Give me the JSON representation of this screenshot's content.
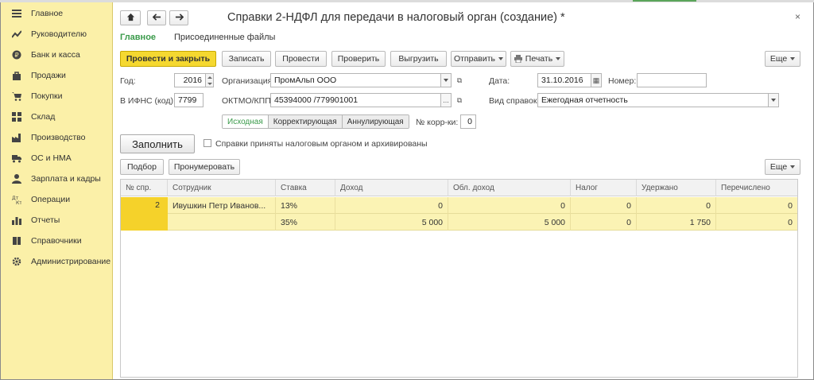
{
  "sidebar": {
    "items": [
      {
        "label": "Главное",
        "icon": "menu-list-icon"
      },
      {
        "label": "Руководителю",
        "icon": "chart-line-icon"
      },
      {
        "label": "Банк и касса",
        "icon": "coin-icon"
      },
      {
        "label": "Продажи",
        "icon": "bag-icon"
      },
      {
        "label": "Покупки",
        "icon": "cart-icon"
      },
      {
        "label": "Склад",
        "icon": "warehouse-icon"
      },
      {
        "label": "Производство",
        "icon": "factory-icon"
      },
      {
        "label": "ОС и НМА",
        "icon": "truck-icon"
      },
      {
        "label": "Зарплата и кадры",
        "icon": "person-icon"
      },
      {
        "label": "Операции",
        "icon": "operations-icon"
      },
      {
        "label": "Отчеты",
        "icon": "bar-chart-icon"
      },
      {
        "label": "Справочники",
        "icon": "book-icon"
      },
      {
        "label": "Администрирование",
        "icon": "gear-icon"
      }
    ]
  },
  "header": {
    "title": "Справки 2-НДФЛ для передачи в налоговый орган (создание) *",
    "close": "×"
  },
  "tabs": {
    "main": "Главное",
    "files": "Присоединенные файлы"
  },
  "toolbar": {
    "post_close": "Провести и закрыть",
    "save": "Записать",
    "post": "Провести",
    "check": "Проверить",
    "upload": "Выгрузить",
    "send": "Отправить",
    "print": "Печать",
    "more": "Еще"
  },
  "form": {
    "year_label": "Год:",
    "year_value": "2016",
    "ifns_label": "В ИФНС (код):",
    "ifns_value": "7799",
    "org_label": "Организация:",
    "org_value": "ПромАльп ООО",
    "oktmo_label": "ОКТМО/КПП:",
    "oktmo_value": "45394000   /779901001",
    "date_label": "Дата:",
    "date_value": "31.10.2016",
    "number_label": "Номер:",
    "number_value": "",
    "kind_label": "Вид справок:",
    "kind_value": "Ежегодная отчетность",
    "segments": [
      "Исходная",
      "Корректирующая",
      "Аннулирующая"
    ],
    "corr_label": "№ корр-ки:",
    "corr_value": "0",
    "fill_button": "Заполнить",
    "archived_label": "Справки приняты налоговым органом и архивированы"
  },
  "table_toolbar": {
    "pick": "Подбор",
    "renumber": "Пронумеровать",
    "more": "Еще"
  },
  "table": {
    "columns": [
      "№ спр.",
      "Сотрудник",
      "Ставка",
      "Доход",
      "Обл. доход",
      "Налог",
      "Удержано",
      "Перечислено"
    ],
    "rows": [
      {
        "num": "2",
        "employee": "Ивушкин Петр Иванов...",
        "rate": "13%",
        "income": "0",
        "taxable": "0",
        "tax": "0",
        "withheld": "0",
        "transferred": "0"
      },
      {
        "num": "",
        "employee": "",
        "rate": "35%",
        "income": "5 000",
        "taxable": "5 000",
        "tax": "0",
        "withheld": "1 750",
        "transferred": "0"
      }
    ]
  }
}
